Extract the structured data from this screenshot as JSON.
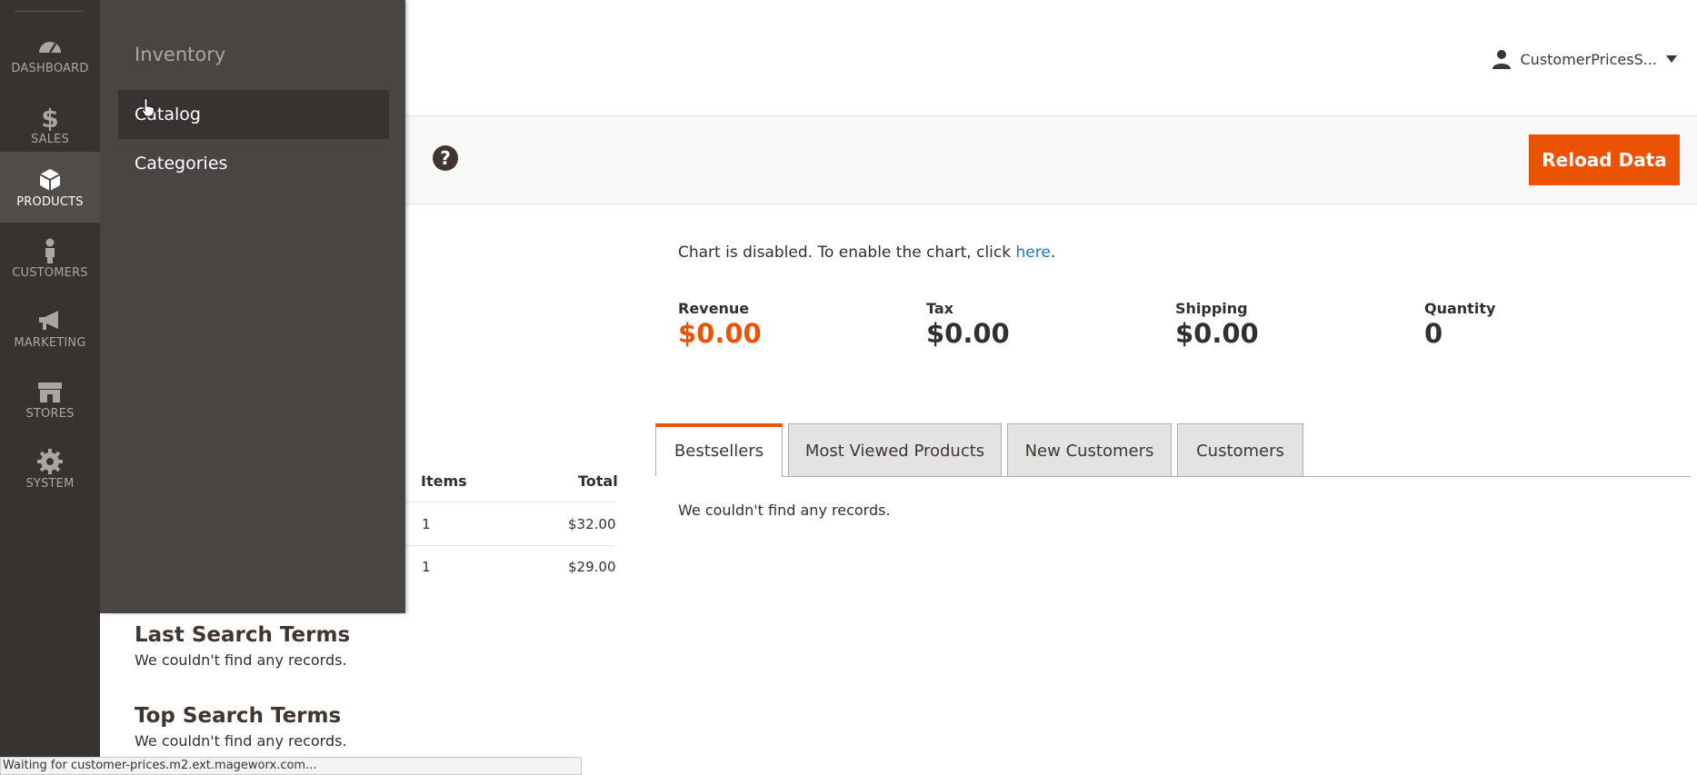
{
  "nav": {
    "items": [
      {
        "label": "DASHBOARD",
        "icon": "dashboard-icon"
      },
      {
        "label": "SALES",
        "icon": "dollar-icon"
      },
      {
        "label": "PRODUCTS",
        "icon": "box-icon"
      },
      {
        "label": "CUSTOMERS",
        "icon": "person-icon"
      },
      {
        "label": "MARKETING",
        "icon": "megaphone-icon"
      },
      {
        "label": "STORES",
        "icon": "store-icon"
      },
      {
        "label": "SYSTEM",
        "icon": "gear-icon"
      }
    ]
  },
  "flyout": {
    "title": "Inventory",
    "items": [
      "Catalog",
      "Categories"
    ]
  },
  "header": {
    "user": "CustomerPricesS..."
  },
  "actions": {
    "reload": "Reload Data",
    "help": "?"
  },
  "chart": {
    "message": "Chart is disabled. To enable the chart, click ",
    "link": "here",
    "period": "."
  },
  "kpis": [
    {
      "label": "Revenue",
      "value": "$0.00"
    },
    {
      "label": "Tax",
      "value": "$0.00"
    },
    {
      "label": "Shipping",
      "value": "$0.00"
    },
    {
      "label": "Quantity",
      "value": "0"
    }
  ],
  "tabs": [
    "Bestsellers",
    "Most Viewed Products",
    "New Customers",
    "Customers"
  ],
  "tab_content": "We couldn't find any records.",
  "orders_table": {
    "headers": [
      "Items",
      "Total"
    ],
    "rows": [
      {
        "items": "1",
        "total": "$32.00"
      },
      {
        "items": "1",
        "total": "$29.00"
      }
    ]
  },
  "sections": [
    {
      "title": "Last Search Terms",
      "message": "We couldn't find any records."
    },
    {
      "title": "Top Search Terms",
      "message": "We couldn't find any records."
    }
  ],
  "status_bar": "Waiting for customer-prices.m2.ext.mageworx.com..."
}
